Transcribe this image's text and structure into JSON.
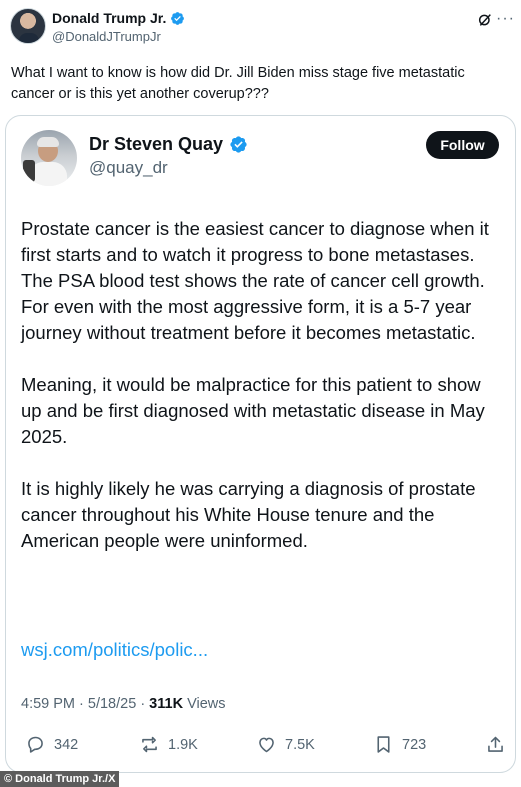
{
  "outer_tweet": {
    "author_name": "Donald Trump Jr.",
    "author_handle": "@DonaldJTrumpJr",
    "text": "What I want to know is how did Dr. Jill Biden miss stage five metastatic cancer or is this yet another coverup???"
  },
  "quoted_tweet": {
    "author_name": "Dr Steven Quay",
    "author_handle": "@quay_dr",
    "follow_label": "Follow",
    "paragraphs": [
      "Prostate cancer is the easiest cancer to diagnose when it first starts and to watch it progress to bone metastases. The PSA blood test shows the rate of cancer cell growth. For even with the most aggressive form, it is a 5-7 year journey without treatment before it becomes metastatic.",
      "Meaning, it would be malpractice for this patient to show up and be first diagnosed with metastatic disease in May 2025.",
      "It is highly likely he was carrying a diagnosis of prostate cancer throughout his White House tenure and the American people were uninformed."
    ],
    "link": "wsj.com/politics/polic...",
    "time": "4:59 PM",
    "date": "5/18/25",
    "views_count": "311K",
    "views_label": "Views",
    "actions": {
      "replies": "342",
      "reposts": "1.9K",
      "likes": "7.5K",
      "bookmarks": "723"
    }
  },
  "watermark": "© Donald Trump Jr./X",
  "colors": {
    "accent_blue": "#1d9bf0",
    "text_primary": "#0f1419",
    "text_secondary": "#536471",
    "border": "#cfd9de"
  },
  "icons": [
    "verified-badge-icon",
    "grok-icon",
    "more-options-icon",
    "reply-icon",
    "repost-icon",
    "like-icon",
    "bookmark-icon",
    "share-icon"
  ]
}
